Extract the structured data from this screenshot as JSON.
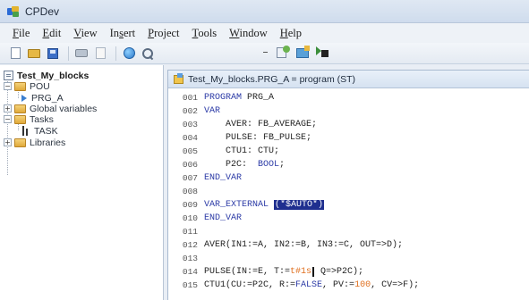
{
  "window": {
    "title": "CPDev"
  },
  "menu": [
    {
      "pre": "",
      "u": "F",
      "post": "ile"
    },
    {
      "pre": "",
      "u": "E",
      "post": "dit"
    },
    {
      "pre": "",
      "u": "V",
      "post": "iew"
    },
    {
      "pre": "In",
      "u": "s",
      "post": "ert"
    },
    {
      "pre": "",
      "u": "P",
      "post": "roject"
    },
    {
      "pre": "",
      "u": "T",
      "post": "ools"
    },
    {
      "pre": "",
      "u": "W",
      "post": "indow"
    },
    {
      "pre": "",
      "u": "H",
      "post": "elp"
    }
  ],
  "toolbar": {
    "icons": [
      "new-file-icon",
      "open-folder-icon",
      "save-icon",
      "print-icon",
      "print-preview-icon",
      "globe-icon",
      "zoom-icon",
      "compile-icon",
      "build-icon",
      "run-icon"
    ]
  },
  "tree": {
    "project": "Test_My_blocks",
    "pou": "POU",
    "prg": "PRG_A",
    "globals": "Global variables",
    "tasks": "Tasks",
    "task": "TASK",
    "libraries": "Libraries"
  },
  "editor": {
    "title": "Test_My_blocks.PRG_A = program (ST)",
    "lines": [
      {
        "n": "001",
        "parts": [
          [
            "kw",
            "PROGRAM"
          ],
          [
            "txt",
            " PRG_A"
          ]
        ]
      },
      {
        "n": "002",
        "parts": [
          [
            "kw",
            "VAR"
          ]
        ]
      },
      {
        "n": "003",
        "parts": [
          [
            "txt",
            "    AVER: FB_AVERAGE;"
          ]
        ]
      },
      {
        "n": "004",
        "parts": [
          [
            "txt",
            "    PULSE: FB_PULSE;"
          ]
        ]
      },
      {
        "n": "005",
        "parts": [
          [
            "txt",
            "    CTU1: CTU;"
          ]
        ]
      },
      {
        "n": "006",
        "parts": [
          [
            "txt",
            "    P2C:  "
          ],
          [
            "kw",
            "BOOL"
          ],
          [
            "txt",
            ";"
          ]
        ]
      },
      {
        "n": "007",
        "parts": [
          [
            "kw",
            "END_VAR"
          ]
        ]
      },
      {
        "n": "008",
        "parts": []
      },
      {
        "n": "009",
        "parts": [
          [
            "kw",
            "VAR_EXTERNAL "
          ],
          [
            "hl",
            "(*$AUTO*)"
          ]
        ]
      },
      {
        "n": "010",
        "parts": [
          [
            "kw",
            "END_VAR"
          ]
        ]
      },
      {
        "n": "011",
        "parts": []
      },
      {
        "n": "012",
        "parts": [
          [
            "txt",
            "AVER(IN1:=A, IN2:=B, IN3:=C, OUT=>D);"
          ]
        ]
      },
      {
        "n": "013",
        "parts": []
      },
      {
        "n": "014",
        "parts": [
          [
            "txt",
            "PULSE(IN:=E, T:="
          ],
          [
            "num",
            "t#1s"
          ],
          [
            "cursor",
            ""
          ],
          [
            "txt",
            " Q=>P2C);"
          ]
        ]
      },
      {
        "n": "015",
        "parts": [
          [
            "txt",
            "CTU1(CU:=P2C, R:="
          ],
          [
            "kw",
            "FALSE"
          ],
          [
            "txt",
            ", PV:="
          ],
          [
            "num",
            "100"
          ],
          [
            "txt",
            ", CV=>F);"
          ]
        ]
      }
    ]
  }
}
